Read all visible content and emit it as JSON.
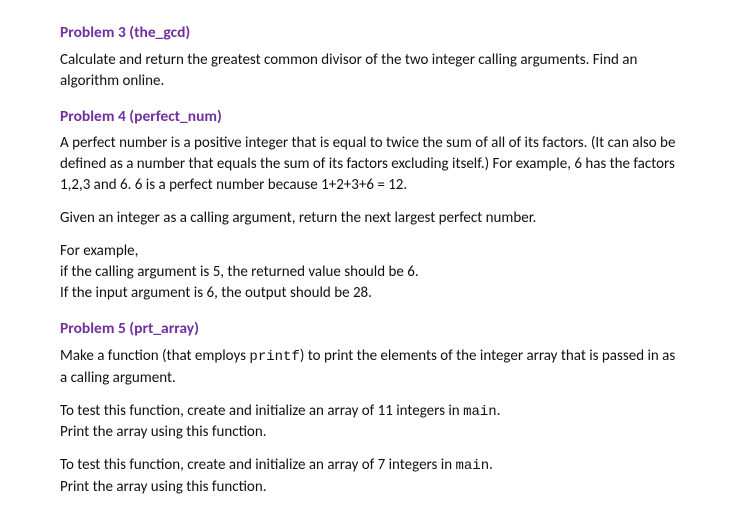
{
  "problems": [
    {
      "title": "Problem 3 (the_gcd)",
      "paragraphs": [
        "Calculate and return the greatest common divisor of the two integer calling arguments. Find an algorithm online."
      ]
    },
    {
      "title": "Problem 4 (perfect_num)",
      "paragraphs": [
        "A perfect number is a positive integer that is equal to twice the sum of all of its factors. (It can also be defined as a number that equals the sum of its factors excluding itself.) For example, 6 has the factors 1,2,3 and 6. 6 is a perfect number because 1+2+3+6 = 12.",
        "Given an integer as a calling argument, return the next largest perfect number.",
        "For example,\nif the calling argument is 5, the returned value should be 6.\nIf the input argument is 6, the output should be 28."
      ]
    },
    {
      "title": "Problem 5 (prt_array)",
      "paragraphs_rich": [
        [
          {
            "t": "Make a function (that employs "
          },
          {
            "t": "printf",
            "code": true
          },
          {
            "t": ") to print the elements of the integer array that is passed in as a calling argument."
          }
        ],
        [
          {
            "t": "To test this function, create and initialize an array of 11 integers in "
          },
          {
            "t": "main",
            "code": true
          },
          {
            "t": ".\nPrint the array using this function."
          }
        ],
        [
          {
            "t": "To test this function, create and initialize an array of 7 integers in "
          },
          {
            "t": "main",
            "code": true
          },
          {
            "t": ".\nPrint the array using this function."
          }
        ]
      ]
    }
  ]
}
